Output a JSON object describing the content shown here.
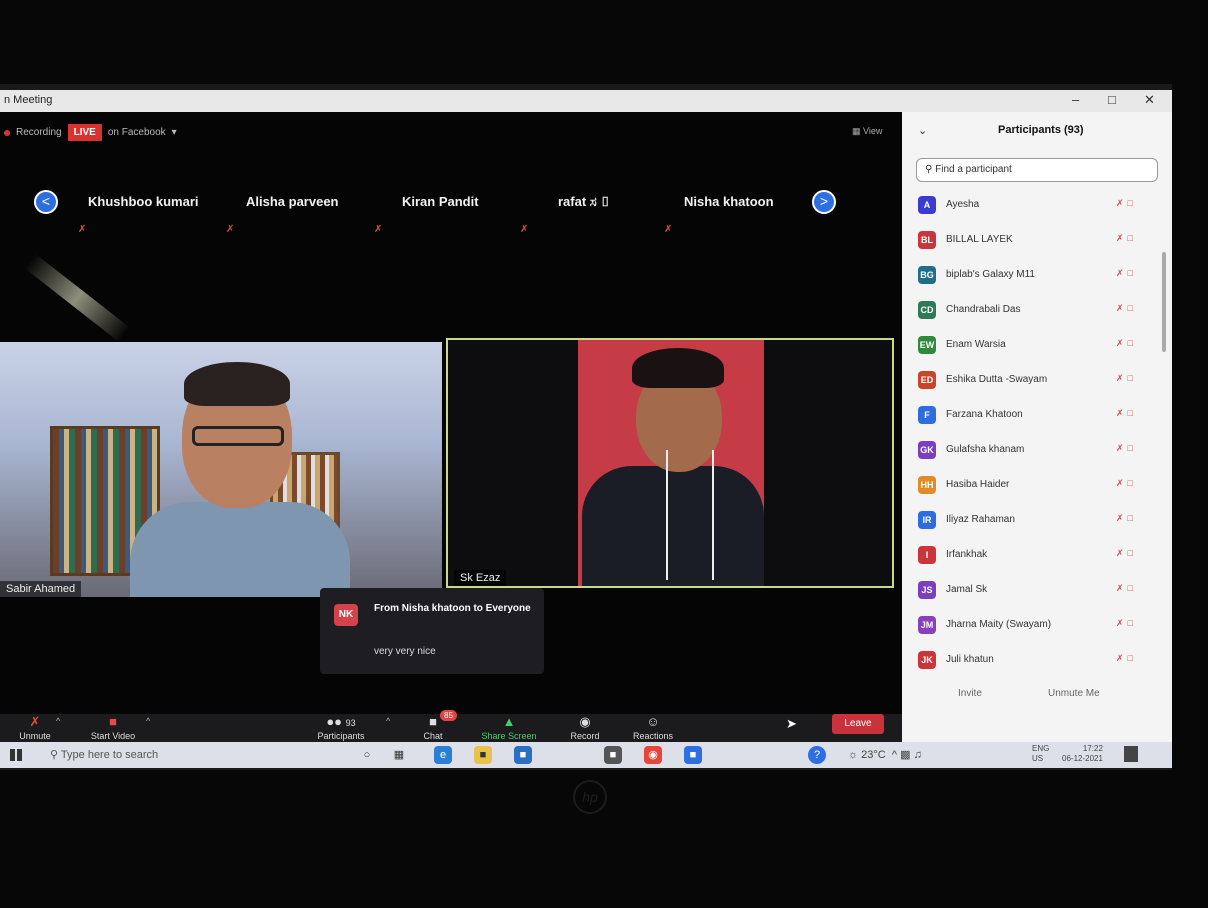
{
  "window": {
    "title": "n Meeting"
  },
  "recording": {
    "label": "Recording",
    "live": "LIVE",
    "destination": "on Facebook",
    "view": "View"
  },
  "strip": {
    "names": [
      "Khushboo kumari",
      "Alisha parveen",
      "Kiran Pandit",
      "rafat ಸ ▯",
      "Nisha khatoon"
    ],
    "prev": "<",
    "next": ">"
  },
  "tiles": {
    "left_name": "Sabir Ahamed",
    "right_name": "Sk Ezaz"
  },
  "chat_popup": {
    "initials": "NK",
    "from": "From Nisha khatoon to Everyone",
    "message": "very very nice"
  },
  "toolbar": {
    "unmute": "Unmute",
    "start_video": "Start Video",
    "participants": "Participants",
    "participants_count": "93",
    "chat": "Chat",
    "chat_badge": "85",
    "share": "Share Screen",
    "record": "Record",
    "reactions": "Reactions",
    "leave": "Leave"
  },
  "panel": {
    "title": "Participants (93)",
    "search_placeholder": "Find a participant",
    "participants": [
      {
        "initials": "A",
        "name": "Ayesha",
        "color": "#3b3bd1"
      },
      {
        "initials": "BL",
        "name": "BILLAL LAYEK",
        "color": "#c9353a"
      },
      {
        "initials": "BG",
        "name": "biplab's Galaxy M11",
        "color": "#1f6f8b"
      },
      {
        "initials": "CD",
        "name": "Chandrabali Das",
        "color": "#2f7a56"
      },
      {
        "initials": "EW",
        "name": "Enam Warsia",
        "color": "#2f8a3c"
      },
      {
        "initials": "ED",
        "name": "Eshika Dutta -Swayam",
        "color": "#c9452a"
      },
      {
        "initials": "F",
        "name": "Farzana Khatoon",
        "color": "#2e6de0"
      },
      {
        "initials": "GK",
        "name": "Gulafsha khanam",
        "color": "#7a3fbf"
      },
      {
        "initials": "HH",
        "name": "Hasiba Haider",
        "color": "#e08a28"
      },
      {
        "initials": "IR",
        "name": "Iliyaz Rahaman",
        "color": "#2e6de0"
      },
      {
        "initials": "I",
        "name": "Irfankhak",
        "color": "#c9353a"
      },
      {
        "initials": "JS",
        "name": "Jamal Sk",
        "color": "#7a3fbf"
      },
      {
        "initials": "JM",
        "name": "Jharna Maity (Swayam)",
        "color": "#8a3fbf"
      },
      {
        "initials": "JK",
        "name": "Juli khatun",
        "color": "#c9353a"
      }
    ],
    "invite": "Invite",
    "unmute_me": "Unmute Me"
  },
  "taskbar": {
    "search": "Type here to search",
    "weather": "23°C",
    "lang": "ENG",
    "region": "US",
    "time": "17:22",
    "date": "06-12-2021"
  },
  "brand": "hp"
}
